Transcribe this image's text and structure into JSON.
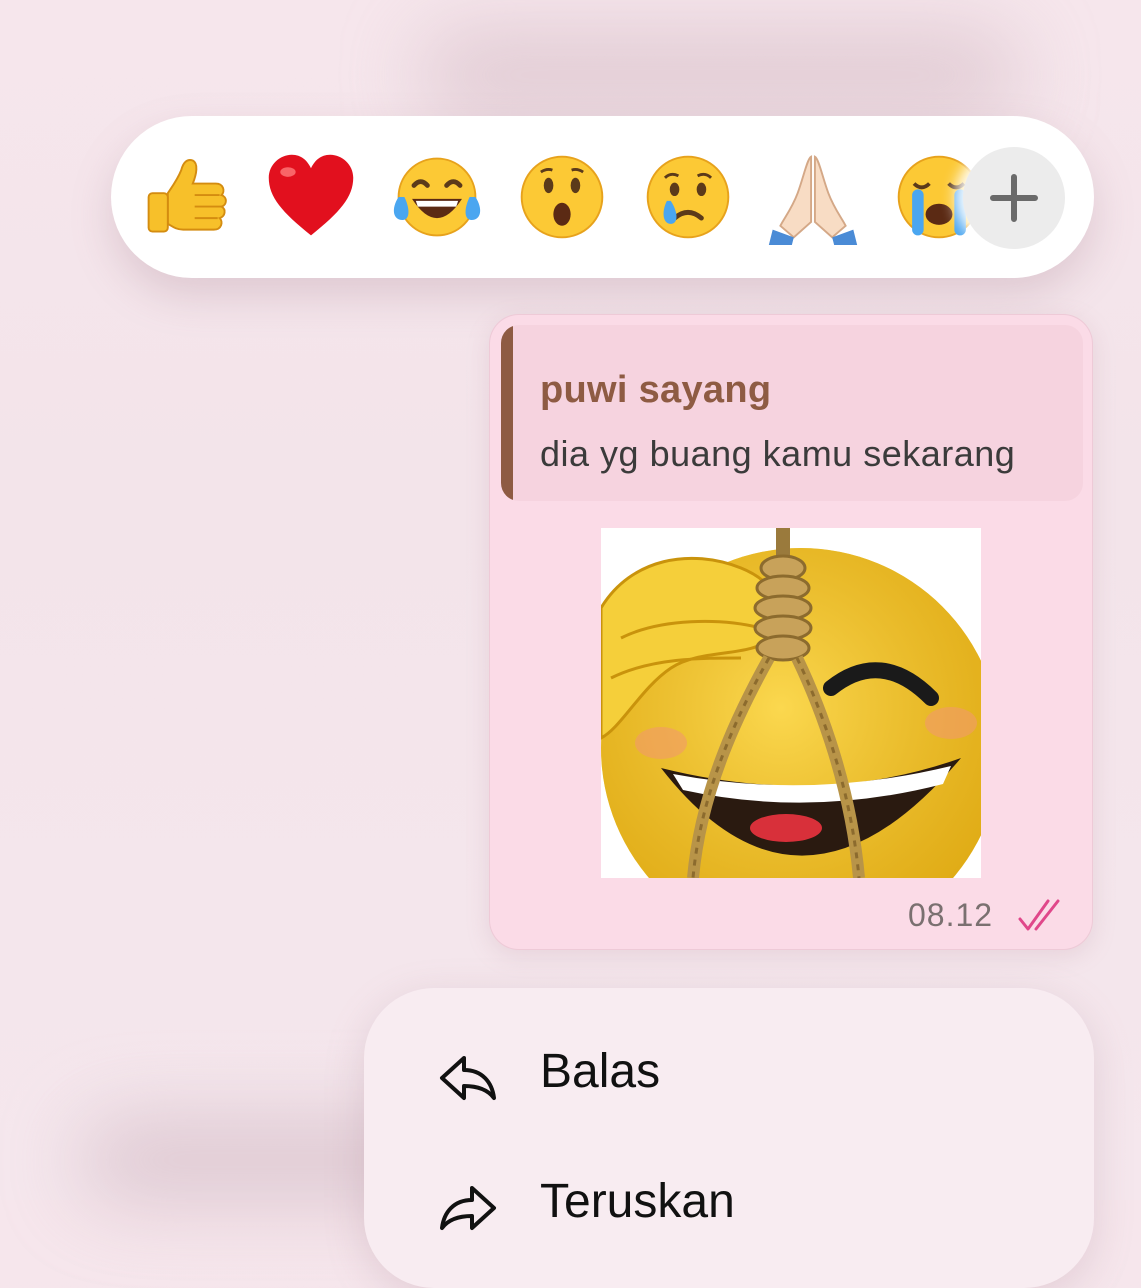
{
  "reactions": {
    "items": [
      {
        "name": "thumbs-up",
        "glyph": "👍"
      },
      {
        "name": "red-heart",
        "glyph": "❤️"
      },
      {
        "name": "tears-of-joy",
        "glyph": "😂"
      },
      {
        "name": "surprised",
        "glyph": "😮"
      },
      {
        "name": "sad-crying",
        "glyph": "😢"
      },
      {
        "name": "folded-hands",
        "glyph": "🙏🏻"
      },
      {
        "name": "loudly-crying",
        "glyph": "😭"
      }
    ],
    "more_icon": "plus-icon"
  },
  "message": {
    "quote": {
      "author": "puwi sayang",
      "text": "dia yg buang kamu sekarang"
    },
    "sticker_icon": "laughing-emoji-noose-sticker",
    "time": "08.12",
    "status_icon": "double-check-icon",
    "status_color": "#e0478a"
  },
  "menu": {
    "reply_label": "Balas",
    "reply_icon": "reply-arrow-icon",
    "forward_label": "Teruskan",
    "forward_icon": "forward-arrow-icon"
  },
  "colors": {
    "background": "#f5e6ec",
    "bubble": "#fbdbe7",
    "quote_background": "#f6d3df",
    "quote_accent": "#8e5b43",
    "menu_background": "#f8ecf1"
  }
}
